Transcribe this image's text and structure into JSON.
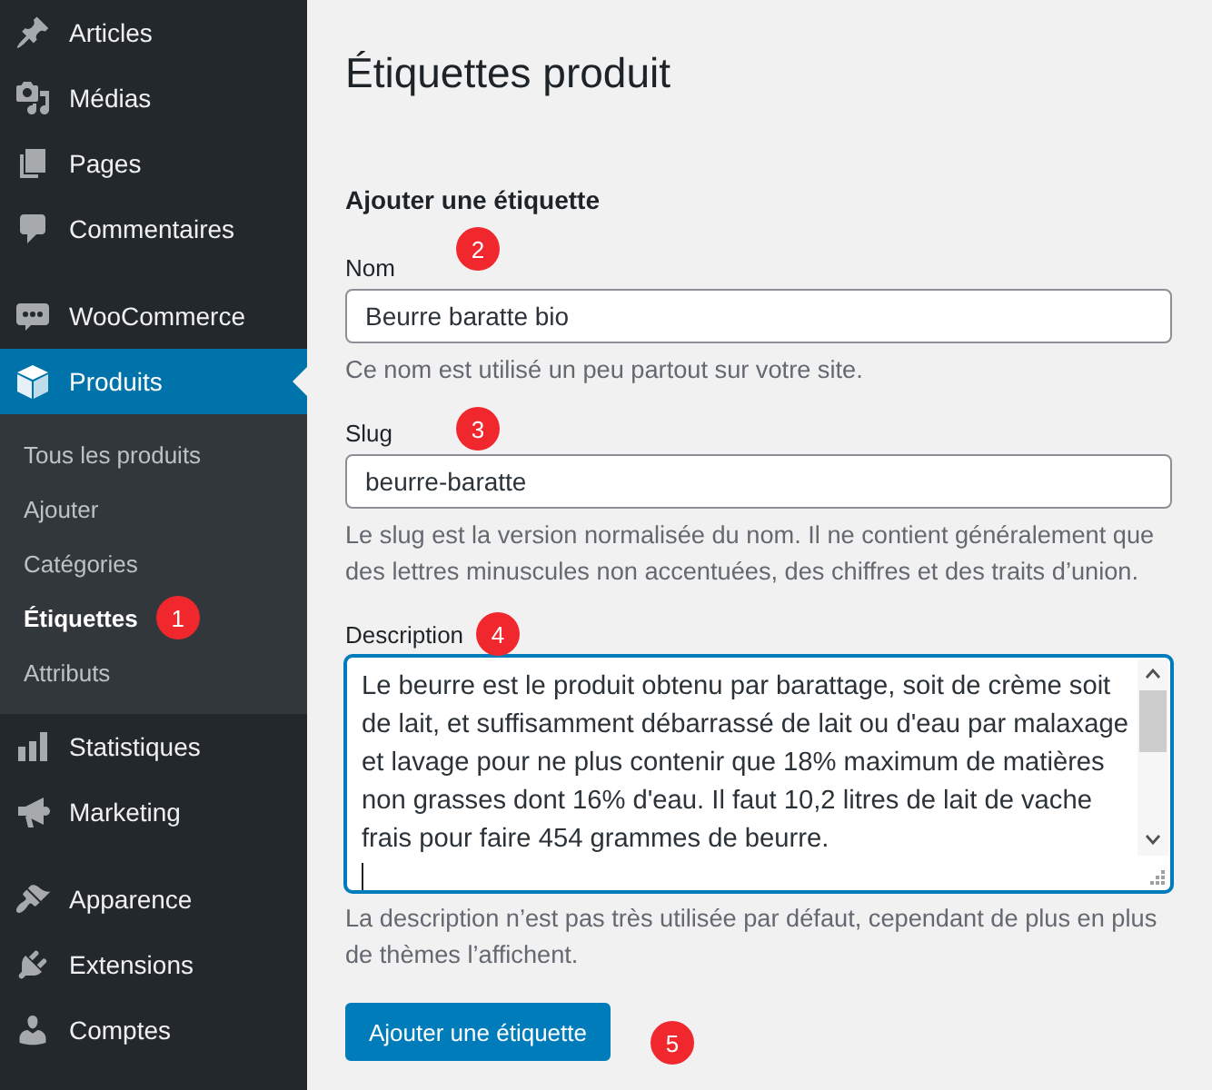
{
  "sidebar": {
    "groups": [
      {
        "items": [
          {
            "label": "Articles",
            "selected": false
          },
          {
            "label": "Médias",
            "selected": false
          },
          {
            "label": "Pages",
            "selected": false
          },
          {
            "label": "Commentaires",
            "selected": false
          }
        ]
      },
      {
        "items": [
          {
            "label": "WooCommerce",
            "selected": false
          },
          {
            "label": "Produits",
            "selected": true,
            "submenu": [
              {
                "label": "Tous les produits",
                "selected": false
              },
              {
                "label": "Ajouter",
                "selected": false
              },
              {
                "label": "Catégories",
                "selected": false
              },
              {
                "label": "Étiquettes",
                "selected": true,
                "marker": "1"
              },
              {
                "label": "Attributs",
                "selected": false
              }
            ]
          },
          {
            "label": "Statistiques",
            "selected": false
          },
          {
            "label": "Marketing",
            "selected": false
          }
        ]
      },
      {
        "items": [
          {
            "label": "Apparence",
            "selected": false
          },
          {
            "label": "Extensions",
            "selected": false
          },
          {
            "label": "Comptes",
            "selected": false
          }
        ]
      }
    ]
  },
  "page": {
    "title": "Étiquettes produit"
  },
  "form": {
    "heading": "Ajouter une étiquette",
    "fields": [
      {
        "kind": "text",
        "label": "Nom",
        "value": "Beurre baratte bio",
        "focused": false,
        "help": "Ce nom est utilisé un peu partout sur votre site.",
        "marker": "2"
      },
      {
        "kind": "text",
        "label": "Slug",
        "value": "beurre-baratte",
        "focused": false,
        "help": "Le slug est la version normalisée du nom. Il ne contient généralement que des lettres minuscules non accentuées, des chiffres et des traits d’union.",
        "marker": "3"
      },
      {
        "kind": "textarea",
        "label": "Description",
        "value": "Le beurre est le produit obtenu par barattage, soit de crème soit de lait, et suffisamment débarrassé de lait ou d'eau par malaxage et lavage pour ne plus contenir que 18% maximum de matières non grasses dont 16% d'eau. Il faut 10,2 litres de lait de vache frais pour faire 454 grammes de beurre.",
        "focused": true,
        "help": "La description n’est pas très utilisée par défaut, cependant de plus en plus de thèmes l’affichent.",
        "marker": "4"
      }
    ],
    "submit": {
      "label": "Ajouter une étiquette",
      "marker": "5"
    }
  }
}
